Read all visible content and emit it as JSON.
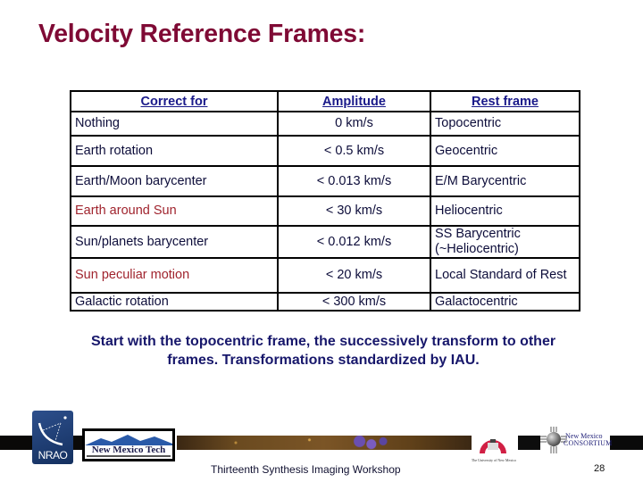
{
  "slide": {
    "title": "Velocity Reference Frames:",
    "table": {
      "headers": [
        "Correct for",
        "Amplitude",
        "Rest frame"
      ],
      "rows": [
        {
          "correct_for": "Nothing",
          "amplitude": "0 km/s",
          "rest_frame": "Topocentric",
          "highlight": false
        },
        {
          "correct_for": "Earth rotation",
          "amplitude": "< 0.5 km/s",
          "rest_frame": "Geocentric",
          "highlight": false
        },
        {
          "correct_for": "Earth/Moon barycenter",
          "amplitude": "< 0.013 km/s",
          "rest_frame": "E/M Barycentric",
          "highlight": false
        },
        {
          "correct_for": "Earth around Sun",
          "amplitude": "< 30 km/s",
          "rest_frame": "Heliocentric",
          "highlight": true
        },
        {
          "correct_for": "Sun/planets barycenter",
          "amplitude": "< 0.012 km/s",
          "rest_frame": "SS Barycentric (~Heliocentric)",
          "highlight": false
        },
        {
          "correct_for": "Sun peculiar motion",
          "amplitude": "< 20 km/s",
          "rest_frame": "Local Standard of Rest",
          "highlight": true
        },
        {
          "correct_for": "Galactic rotation",
          "amplitude": "< 300 km/s",
          "rest_frame": "Galactocentric",
          "highlight": false
        }
      ]
    },
    "caption": "Start with the topocentric frame, the successively transform to other frames. Transformations standardized by IAU."
  },
  "footer": {
    "workshop": "Thirteenth Synthesis Imaging Workshop",
    "page_number": "28",
    "logos": {
      "nrao": "NRAO",
      "nmt": "New Mexico Tech",
      "unm": "The University of New Mexico",
      "nmc_line1": "New Mexico",
      "nmc_line2": "CONSORTIUM"
    }
  },
  "colors": {
    "title": "#7f0a35",
    "header_text": "#1a1a8a",
    "highlight_text": "#a0242e",
    "caption": "#17176b"
  }
}
